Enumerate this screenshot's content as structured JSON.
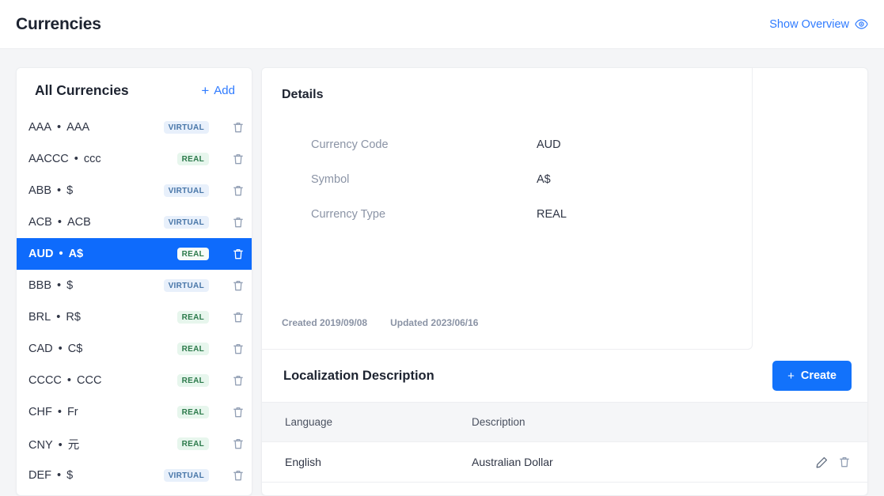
{
  "header": {
    "title": "Currencies",
    "overview_label": "Show Overview",
    "overview_icon": "eye-icon"
  },
  "sidebar": {
    "title": "All Currencies",
    "add_label": "Add",
    "add_icon": "plus-icon",
    "delete_icon": "trash-icon",
    "items": [
      {
        "code": "AAA",
        "symbol": "AAA",
        "type": "VIRTUAL",
        "selected": false
      },
      {
        "code": "AACCC",
        "symbol": "ccc",
        "type": "REAL",
        "selected": false
      },
      {
        "code": "ABB",
        "symbol": "$",
        "type": "VIRTUAL",
        "selected": false
      },
      {
        "code": "ACB",
        "symbol": "ACB",
        "type": "VIRTUAL",
        "selected": false
      },
      {
        "code": "AUD",
        "symbol": "A$",
        "type": "REAL",
        "selected": true
      },
      {
        "code": "BBB",
        "symbol": "$",
        "type": "VIRTUAL",
        "selected": false
      },
      {
        "code": "BRL",
        "symbol": "R$",
        "type": "REAL",
        "selected": false
      },
      {
        "code": "CAD",
        "symbol": "C$",
        "type": "REAL",
        "selected": false
      },
      {
        "code": "CCCC",
        "symbol": "CCC",
        "type": "REAL",
        "selected": false
      },
      {
        "code": "CHF",
        "symbol": "Fr",
        "type": "REAL",
        "selected": false
      },
      {
        "code": "CNY",
        "symbol": "元",
        "type": "REAL",
        "selected": false
      },
      {
        "code": "DEF",
        "symbol": "$",
        "type": "VIRTUAL",
        "selected": false
      }
    ]
  },
  "details": {
    "title": "Details",
    "fields": [
      {
        "label": "Currency Code",
        "value": "AUD"
      },
      {
        "label": "Symbol",
        "value": "A$"
      },
      {
        "label": "Currency Type",
        "value": "REAL"
      }
    ],
    "created": "Created 2019/09/08",
    "updated": "Updated 2023/06/16"
  },
  "localization": {
    "title": "Localization Description",
    "create_label": "Create",
    "create_icon": "plus-icon",
    "columns": [
      "Language",
      "Description"
    ],
    "rows": [
      {
        "language": "English",
        "description": "Australian Dollar",
        "edit_icon": "pencil-icon",
        "delete_icon": "trash-icon"
      }
    ]
  },
  "colors": {
    "accent": "#1272fb",
    "selected_row": "#0e6bfc",
    "link": "#2f7bff",
    "badge_virtual_bg": "#e8f0fb",
    "badge_virtual_fg": "#4876a8",
    "badge_real_bg": "#e7f6ed",
    "badge_real_fg": "#2c7a4b",
    "page_bg": "#f4f5f7"
  }
}
